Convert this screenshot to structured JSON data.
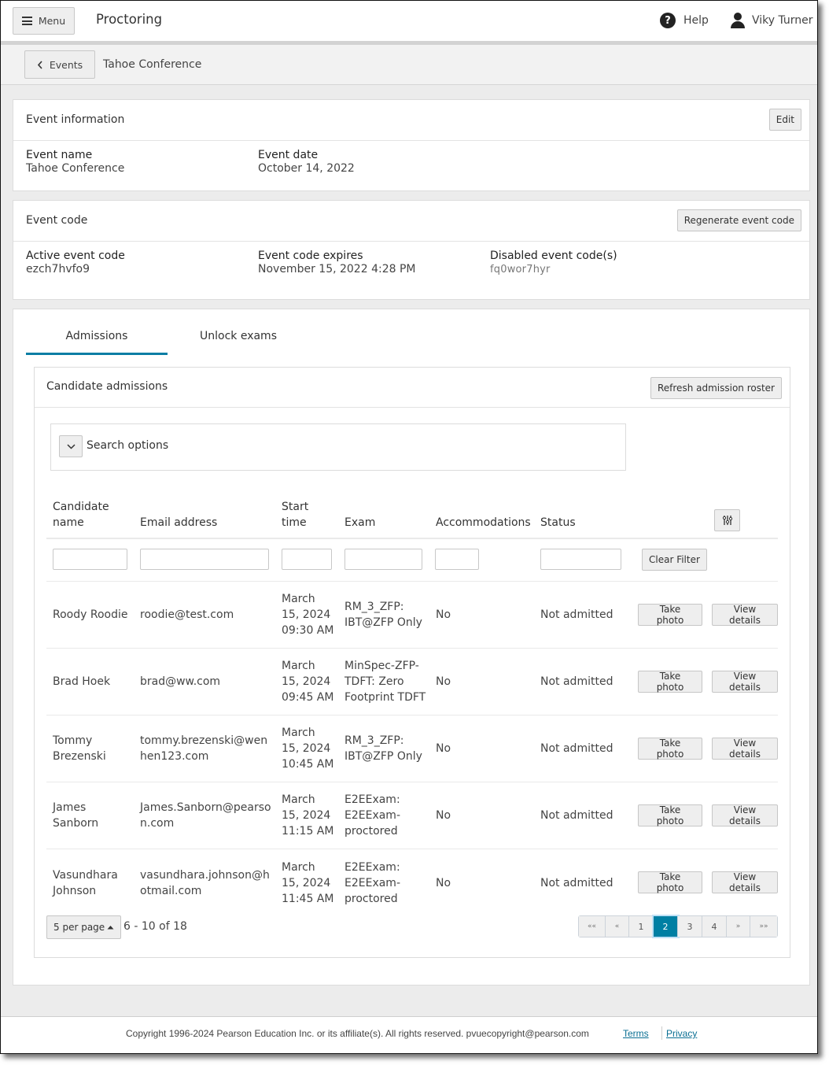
{
  "header": {
    "menu_label": "Menu",
    "app_title": "Proctoring",
    "help_label": "Help",
    "user_name": "Viky Turner"
  },
  "breadcrumb": {
    "back_label": "Events",
    "current": "Tahoe Conference"
  },
  "event_information": {
    "title": "Event information",
    "edit_label": "Edit",
    "fields": [
      {
        "label": "Event name",
        "value": "Tahoe Conference"
      },
      {
        "label": "Event date",
        "value": "October 14, 2022"
      }
    ]
  },
  "event_code": {
    "title": "Event code",
    "regenerate_label": "Regenerate event code",
    "fields": [
      {
        "label": "Active event code",
        "value": "ezch7hvfo9"
      },
      {
        "label": "Event code expires",
        "value": "November 15, 2022 4:28 PM"
      },
      {
        "label": "Disabled event code(s)",
        "value": "fq0wor7hyr"
      }
    ]
  },
  "tabs": [
    {
      "label": "Admissions",
      "active": true
    },
    {
      "label": "Unlock exams",
      "active": false
    }
  ],
  "admissions": {
    "title": "Candidate admissions",
    "refresh_label": "Refresh admission roster",
    "search_options_label": "Search options",
    "columns": [
      {
        "line1": "Candidate",
        "line2": "name"
      },
      {
        "line1": "",
        "line2": "Email address"
      },
      {
        "line1": "Start",
        "line2": "time"
      },
      {
        "line1": "",
        "line2": "Exam"
      },
      {
        "line1": "",
        "line2": "Accommodations"
      },
      {
        "line1": "",
        "line2": "Status"
      }
    ],
    "filters": {
      "candidate_name": "",
      "email": "",
      "start_time": "",
      "exam": "",
      "accommodations": "",
      "status": ""
    },
    "clear_filter_label": "Clear Filter",
    "take_photo_label": "Take photo",
    "view_details_label": "View details",
    "rows": [
      {
        "name": [
          "Roody Roodie"
        ],
        "email": [
          "roodie@test.com"
        ],
        "start": [
          "March",
          "15, 2024",
          "09:30 AM"
        ],
        "exam": [
          "RM_3_ZFP:",
          "IBT@ZFP Only"
        ],
        "accommodations": "No",
        "status": "Not admitted"
      },
      {
        "name": [
          "Brad Hoek"
        ],
        "email": [
          "brad@ww.com"
        ],
        "start": [
          "March",
          "15, 2024",
          "09:45 AM"
        ],
        "exam": [
          "MinSpec-ZFP-",
          "TDFT: Zero",
          "Footprint TDFT"
        ],
        "accommodations": "No",
        "status": "Not admitted"
      },
      {
        "name": [
          "Tommy",
          "Brezenski"
        ],
        "email": [
          "tommy.brezenski@wen",
          "hen123.com"
        ],
        "start": [
          "March",
          "15, 2024",
          "10:45 AM"
        ],
        "exam": [
          "RM_3_ZFP:",
          "IBT@ZFP Only"
        ],
        "accommodations": "No",
        "status": "Not admitted"
      },
      {
        "name": [
          "James",
          "Sanborn"
        ],
        "email": [
          "James.Sanborn@pearso",
          "n.com"
        ],
        "start": [
          "March",
          "15, 2024",
          "11:15 AM"
        ],
        "exam": [
          "E2EExam:",
          "E2EExam-",
          "proctored"
        ],
        "accommodations": "No",
        "status": "Not admitted"
      },
      {
        "name": [
          "Vasundhara",
          "Johnson"
        ],
        "email": [
          "vasundhara.johnson@h",
          "otmail.com"
        ],
        "start": [
          "March",
          "15, 2024",
          "11:45 AM"
        ],
        "exam": [
          "E2EExam:",
          "E2EExam-",
          "proctored"
        ],
        "accommodations": "No",
        "status": "Not admitted"
      }
    ],
    "per_page_label": "5 per page",
    "range_label": "6 - 10 of 18",
    "pagination": {
      "first": "««",
      "prev": "«",
      "pages": [
        "1",
        "2",
        "3",
        "4"
      ],
      "current_page": "2",
      "next": "»",
      "last": "»»"
    }
  },
  "footer": {
    "copyright": "Copyright 1996-2024 Pearson Education Inc. or its affiliate(s). All rights reserved. pvuecopyright@pearson.com",
    "terms_label": "Terms",
    "privacy_label": "Privacy"
  },
  "colors": {
    "accent": "#007fa3",
    "tab_underline": "#0a7ea4",
    "link": "#0a6f93"
  }
}
